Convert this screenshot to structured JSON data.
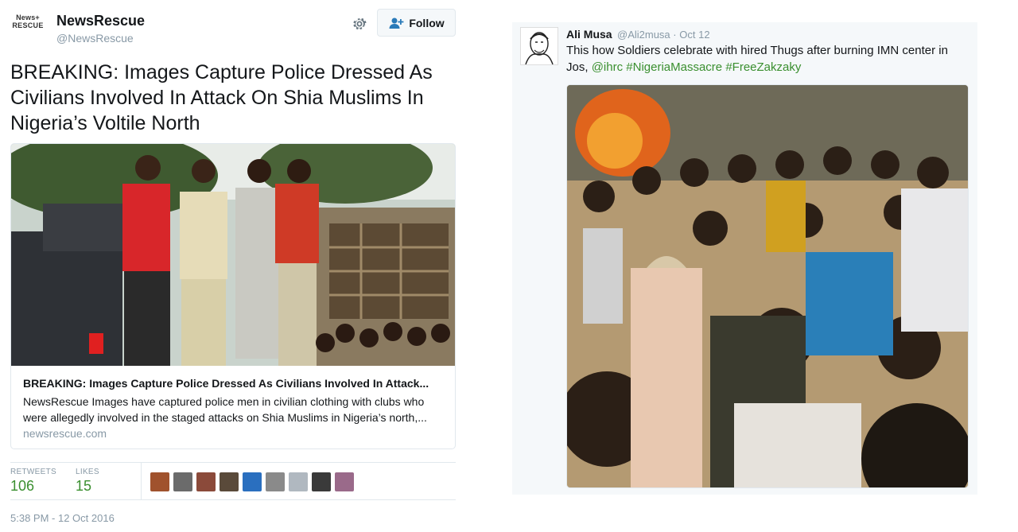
{
  "left_tweet": {
    "avatar": {
      "line1": "News+",
      "line2": "RESCUE"
    },
    "account_name": "NewsRescue",
    "handle": "@NewsRescue",
    "follow_label": "Follow",
    "text": "BREAKING: Images Capture Police Dressed As Civilians Involved In Attack On Shia Muslims In Nigeria’s Voltile North",
    "card": {
      "title": "BREAKING: Images Capture Police Dressed As Civilians Involved In Attack...",
      "description": "NewsRescue Images have captured police men in civilian clothing with clubs who were allegedly involved in the staged attacks on Shia Muslims in Nigeria’s north,...",
      "domain": "newsrescue.com"
    },
    "stats": {
      "retweets_label": "RETWEETS",
      "retweets": "106",
      "likes_label": "LIKES",
      "likes": "15"
    },
    "liker_colors": [
      "#a0522d",
      "#6b6b6b",
      "#8b4a3a",
      "#5a4a3a",
      "#2a6fbf",
      "#8a8a8a",
      "#b0b8c0",
      "#3a3a3a",
      "#9a6a8a"
    ],
    "timestamp": "5:38 PM - 12 Oct 2016"
  },
  "right_tweet": {
    "name": "Ali Musa",
    "handle": "@Ali2musa",
    "separator": "·",
    "date": "Oct 12",
    "text_plain": "This how Soldiers celebrate with hired Thugs after burning IMN center in Jos,",
    "link_mention": "@ihrc",
    "link_tag1": "#NigeriaMassacre",
    "link_tag2": "#FreeZakzaky"
  },
  "colors": {
    "link_green": "#3a8f2f",
    "muted": "#8899a6",
    "border": "#e1e8ed"
  }
}
